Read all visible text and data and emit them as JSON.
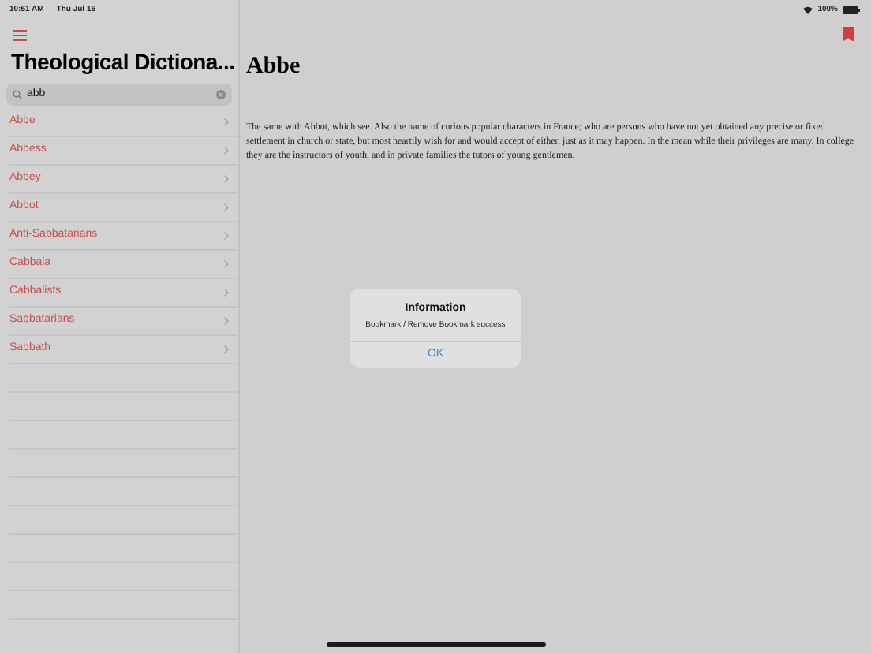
{
  "status_bar": {
    "time": "10:51 AM",
    "date": "Thu Jul 16",
    "battery": "100%"
  },
  "sidebar": {
    "title": "Theological Dictiona...",
    "search": {
      "value": "abb"
    },
    "items": [
      {
        "label": "Abbe"
      },
      {
        "label": "Abbess"
      },
      {
        "label": "Abbey"
      },
      {
        "label": "Abbot"
      },
      {
        "label": "Anti-Sabbatarians"
      },
      {
        "label": "Cabbala"
      },
      {
        "label": "Cabbalists"
      },
      {
        "label": "Sabbatarians"
      },
      {
        "label": "Sabbath"
      }
    ]
  },
  "article": {
    "bookmarked": true,
    "title": "Abbe",
    "body": "The same with Abbot, which see. Also the name of curious popular characters in France; who are persons who have not yet obtained any precise or fixed settlement in church or state, but most heartily wish for and would accept of either, just as it may happen. In the mean while their privileges are many. In college they are the instructors of youth, and in private families the tutors of young gentlemen."
  },
  "alert": {
    "title": "Information",
    "message": "Bookmark / Remove Bookmark success",
    "buttons": [
      "OK"
    ]
  }
}
